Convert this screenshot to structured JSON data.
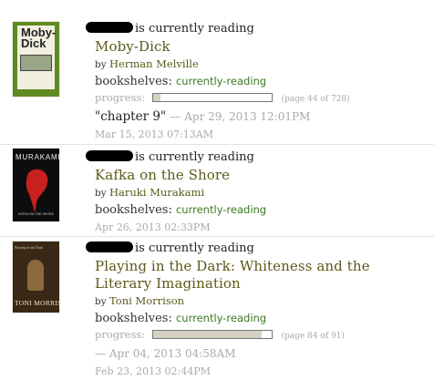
{
  "items": [
    {
      "actor_action": "is currently reading",
      "title": "Moby-Dick",
      "by_label": "by",
      "author": "Herman Melville",
      "bookshelves_label": "bookshelves:",
      "shelf": "currently-reading",
      "progress_label": "progress:",
      "progress_fraction": 0.06,
      "page_info": "(page 44 of 728)",
      "comment": "\"chapter 9\"",
      "comment_timestamp": "— Apr 29, 2013 12:01PM",
      "timestamp": "Mar 15, 2013 07:13AM",
      "cover": {
        "title_lines": [
          "Moby-",
          "Dick"
        ],
        "bg": "#5f8a21"
      }
    },
    {
      "actor_action": "is currently reading",
      "title": "Kafka on the Shore",
      "by_label": "by",
      "author": "Haruki Murakami",
      "bookshelves_label": "bookshelves:",
      "shelf": "currently-reading",
      "timestamp": "Apr 26, 2013 02:33PM",
      "cover": {
        "top_text": "MURAKAMI",
        "bottom_text": "KAFKA ON THE SHORE",
        "bg": "#0d0d0d",
        "accent": "#c81f1f"
      }
    },
    {
      "actor_action": "is currently reading",
      "title": "Playing in the Dark: Whiteness and the Literary Imagination",
      "by_label": "by",
      "author": "Toni Morrison",
      "bookshelves_label": "bookshelves:",
      "shelf": "currently-reading",
      "progress_label": "progress:",
      "progress_fraction": 0.92,
      "page_info": "(page 84 of 91)",
      "update_timestamp": "— Apr 04, 2013 04:58AM",
      "timestamp": "Feb 23, 2013 02:44PM",
      "cover": {
        "top_text": "Playing in the Dark",
        "bottom_text": "TONI MORRISON",
        "bg": "#3a2816"
      }
    }
  ],
  "colors": {
    "title_link": "#5c5a1a",
    "shelf_link": "#3c7a22",
    "muted": "#aaaaaa",
    "divider": "#e3e3e3"
  }
}
